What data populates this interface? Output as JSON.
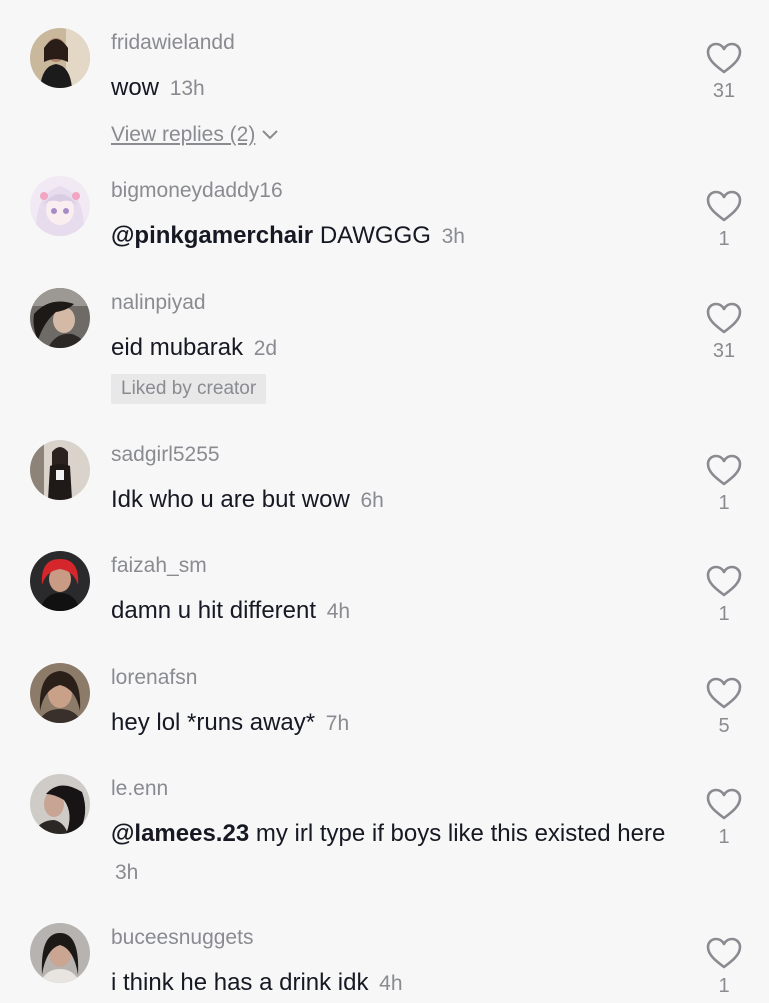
{
  "comments": [
    {
      "username": "fridawielandd",
      "text": "wow",
      "time": "13h",
      "likes": "31",
      "replies_label": "View replies (2)",
      "avatar": "avatar-photo"
    },
    {
      "username": "bigmoneydaddy16",
      "mention": "@pinkgamerchair",
      "text": "DAWGGG",
      "time": "3h",
      "likes": "1",
      "avatar": "avatar-anime-girl"
    },
    {
      "username": "nalinpiyad",
      "text": "eid mubarak",
      "time": "2d",
      "likes": "31",
      "badge": "Liked by creator",
      "avatar": "avatar-photo"
    },
    {
      "username": "sadgirl5255",
      "text": "Idk who u are but wow",
      "time": "6h",
      "likes": "1",
      "avatar": "avatar-photo"
    },
    {
      "username": "faizah_sm",
      "text": "damn u hit different",
      "time": "4h",
      "likes": "1",
      "avatar": "avatar-photo"
    },
    {
      "username": "lorenafsn",
      "text": "hey lol *runs away*",
      "time": "7h",
      "likes": "5",
      "avatar": "avatar-photo"
    },
    {
      "username": "le.enn",
      "mention": "@lamees.23",
      "text": "my irl type if boys like this existed here",
      "time": "3h",
      "likes": "1",
      "avatar": "avatar-photo"
    },
    {
      "username": "buceesnuggets",
      "text": "i think he has a drink idk",
      "time": "4h",
      "likes": "1",
      "avatar": "avatar-photo"
    }
  ],
  "icons": {
    "like": "heart-outline-icon",
    "expand": "chevron-down-icon"
  },
  "colors": {
    "background": "#f7f7f7",
    "text": "#161823",
    "secondary": "#8a8b91",
    "badge_bg": "#e8e8e8"
  }
}
